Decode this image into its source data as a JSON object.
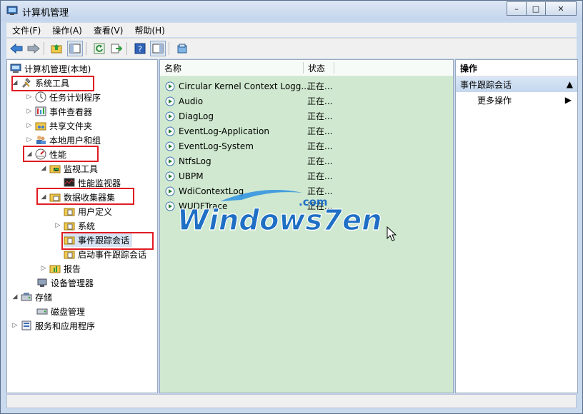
{
  "window": {
    "title": "计算机管理",
    "min": "–",
    "max": "□",
    "close": "✕"
  },
  "menu": [
    "文件(F)",
    "操作(A)",
    "查看(V)",
    "帮助(H)"
  ],
  "tree": {
    "root": "计算机管理(本地)",
    "system_tools": "系统工具",
    "task_scheduler": "任务计划程序",
    "event_viewer": "事件查看器",
    "shared_folders": "共享文件夹",
    "local_users": "本地用户和组",
    "performance": "性能",
    "monitor_tools": "监视工具",
    "perf_monitor": "性能监视器",
    "data_collector_sets": "数据收集器集",
    "user_defined": "用户定义",
    "system": "系统",
    "event_trace_sessions": "事件跟踪会话",
    "startup_event_trace": "启动事件跟踪会话",
    "reports": "报告",
    "device_manager": "设备管理器",
    "storage": "存储",
    "disk_management": "磁盘管理",
    "services_apps": "服务和应用程序"
  },
  "list": {
    "col_name": "名称",
    "col_status": "状态",
    "rows": [
      {
        "name": "Circular Kernel Context Logg...",
        "status": "正在..."
      },
      {
        "name": "Audio",
        "status": "正在..."
      },
      {
        "name": "DiagLog",
        "status": "正在..."
      },
      {
        "name": "EventLog-Application",
        "status": "正在..."
      },
      {
        "name": "EventLog-System",
        "status": "正在..."
      },
      {
        "name": "NtfsLog",
        "status": "正在..."
      },
      {
        "name": "UBPM",
        "status": "正在..."
      },
      {
        "name": "WdiContextLog",
        "status": "正在..."
      },
      {
        "name": "WUDFTrace",
        "status": "正在..."
      }
    ]
  },
  "actions": {
    "header": "操作",
    "section": "事件跟踪会话",
    "more": "更多操作"
  },
  "watermark": {
    "brand": "Windows7en",
    "suffix": ".com"
  },
  "colors": {
    "highlight": "#e01b22",
    "list_bg": "#cfe8cf",
    "accent": "#1f6fc5"
  }
}
